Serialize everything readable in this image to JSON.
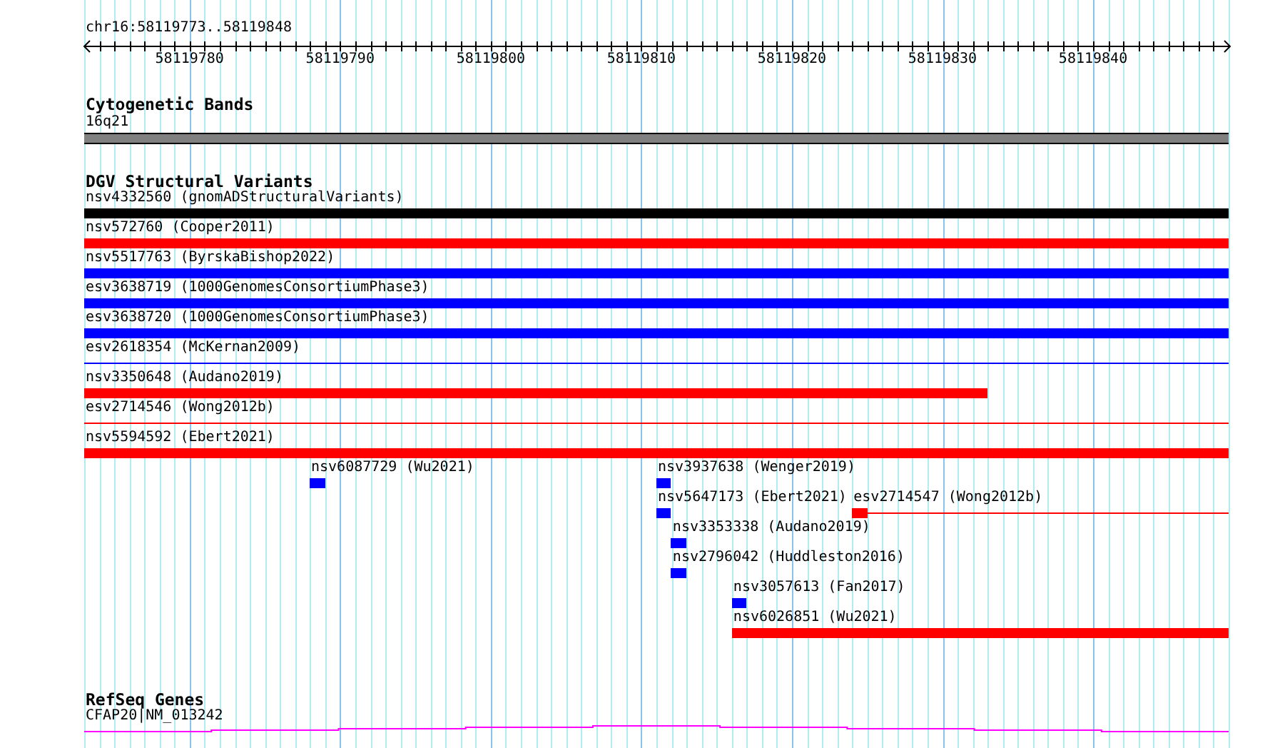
{
  "ruler": {
    "location": "chr16:58119773..58119848",
    "tick_labels": [
      "58119780",
      "58119790",
      "58119800",
      "58119810",
      "58119820",
      "58119830",
      "58119840"
    ]
  },
  "cytogenetic_bands": {
    "title": "Cytogenetic Bands",
    "bands": [
      {
        "name": "16q21"
      }
    ]
  },
  "structural_variants": {
    "title": "DGV Structural Variants",
    "rows": [
      [
        {
          "label": "nsv4332560 (gnomADStructuralVariants)",
          "color": "#000000",
          "kind": "thick"
        }
      ],
      [
        {
          "label": "nsv572760 (Cooper2011)",
          "color": "#ff0000",
          "kind": "thick"
        }
      ],
      [
        {
          "label": "nsv5517763 (ByrskaBishop2022)",
          "color": "#0000ff",
          "kind": "thick"
        }
      ],
      [
        {
          "label": "esv3638719 (1000GenomesConsortiumPhase3)",
          "color": "#0000ff",
          "kind": "thick"
        }
      ],
      [
        {
          "label": "esv3638720 (1000GenomesConsortiumPhase3)",
          "color": "#0000ff",
          "kind": "thick"
        }
      ],
      [
        {
          "label": "esv2618354 (McKernan2009)",
          "color": "#0000ff",
          "kind": "thin"
        }
      ],
      [
        {
          "label": "nsv3350648 (Audano2019)",
          "color": "#ff0000",
          "kind": "thick"
        }
      ],
      [
        {
          "label": "esv2714546 (Wong2012b)",
          "color": "#ff0000",
          "kind": "thin"
        }
      ],
      [
        {
          "label": "nsv5594592 (Ebert2021)",
          "color": "#ff0000",
          "kind": "thick"
        }
      ],
      [
        {
          "label": "nsv6087729 (Wu2021)",
          "color": "#0000ff",
          "kind": "thick"
        },
        {
          "label": "nsv3937638 (Wenger2019)",
          "color": "#0000ff",
          "kind": "thick"
        }
      ],
      [
        {
          "label": "nsv5647173 (Ebert2021)",
          "color": "#0000ff",
          "kind": "thick"
        },
        {
          "label": "esv2714547 (Wong2012b)",
          "color": "#ff0000",
          "kind": "thick-then-thin"
        }
      ],
      [
        {
          "label": "nsv3353338 (Audano2019)",
          "color": "#0000ff",
          "kind": "thick"
        }
      ],
      [
        {
          "label": "nsv2796042 (Huddleston2016)",
          "color": "#0000ff",
          "kind": "thick"
        }
      ],
      [
        {
          "label": "nsv3057613 (Fan2017)",
          "color": "#0000ff",
          "kind": "thick"
        }
      ],
      [
        {
          "label": "nsv6026851 (Wu2021)",
          "color": "#ff0000",
          "kind": "thick"
        }
      ]
    ]
  },
  "refseq_genes": {
    "title": "RefSeq Genes",
    "genes": [
      {
        "name": "CFAP20|NM_013242"
      }
    ]
  }
}
